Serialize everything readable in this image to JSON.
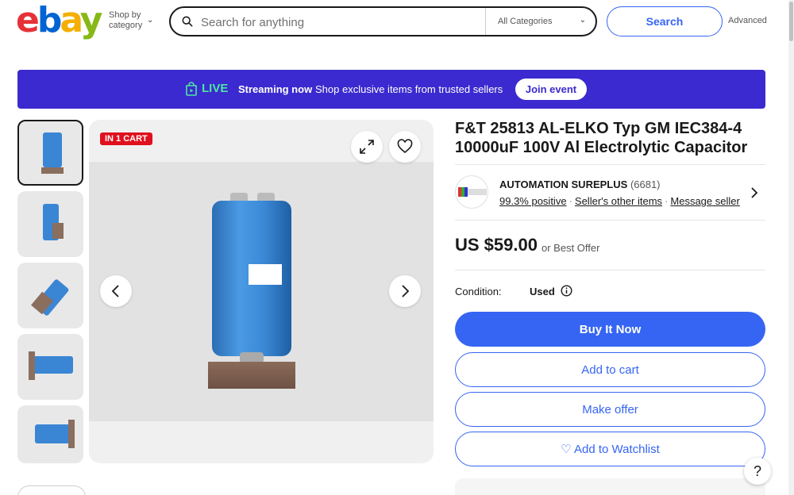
{
  "header": {
    "logo_letters": [
      "e",
      "b",
      "a",
      "y"
    ],
    "shop_by_line1": "Shop by",
    "shop_by_line2": "category",
    "search_placeholder": "Search for anything",
    "category_select": "All Categories",
    "search_button": "Search",
    "advanced_link": "Advanced"
  },
  "banner": {
    "live_label": "LIVE",
    "streaming_label": "Streaming now",
    "message": "Shop exclusive items from trusted sellers",
    "join_button": "Join event"
  },
  "gallery": {
    "badge": "IN 1 CART",
    "thumbnail_count": 5,
    "selected_index": 0
  },
  "product": {
    "title": "F&T 25813 AL-ELKO Typ GM IEC384-4 10000uF 100V Al Electrolytic Capacitor",
    "price": "US $59.00",
    "best_offer": "or Best Offer",
    "condition_label": "Condition:",
    "condition_value": "Used"
  },
  "seller": {
    "name": "AUTOMATION SUREPLUS",
    "feedback_count": "(6681)",
    "positive": "99.3% positive",
    "other_items": "Seller's other items",
    "message": "Message seller"
  },
  "actions": {
    "buy_now": "Buy It Now",
    "add_to_cart": "Add to cart",
    "make_offer": "Make offer",
    "add_to_watchlist": "♡ Add to Watchlist"
  },
  "help": "?",
  "colors": {
    "brand_blue": "#3665f3",
    "banner_purple": "#3b2acf",
    "live_green": "#4de6a4",
    "cart_badge_red": "#e0101e"
  }
}
